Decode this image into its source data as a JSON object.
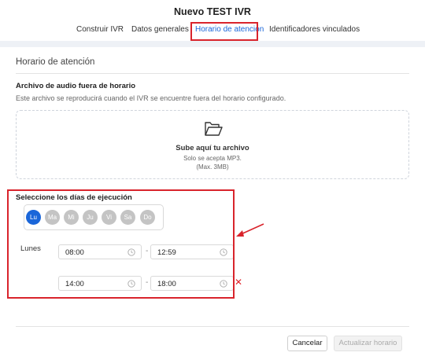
{
  "header": {
    "title": "Nuevo TEST IVR",
    "tabs": [
      {
        "label": "Construir IVR"
      },
      {
        "label": "Datos generales"
      },
      {
        "label": "Horario de atención",
        "active": true
      },
      {
        "label": "Identificadores vinculados"
      }
    ]
  },
  "section": {
    "title": "Horario de atención"
  },
  "audio": {
    "heading": "Archivo de audio fuera de horario",
    "help": "Este archivo se reproducirá cuando el IVR se encuentre fuera del horario configurado.",
    "dropzone": {
      "icon": "folder-open-icon",
      "main": "Sube aquí tu archivo",
      "sub1": "Solo se acepta MP3.",
      "sub2": "(Max. 3MB)"
    }
  },
  "schedule": {
    "heading": "Seleccione los días de ejecución",
    "days": [
      {
        "label": "Lu",
        "selected": true
      },
      {
        "label": "Ma",
        "selected": false
      },
      {
        "label": "Mi",
        "selected": false
      },
      {
        "label": "Ju",
        "selected": false
      },
      {
        "label": "Vi",
        "selected": false
      },
      {
        "label": "Sa",
        "selected": false
      },
      {
        "label": "Do",
        "selected": false
      }
    ],
    "day_name": "Lunes",
    "ranges": [
      {
        "start": "08:00",
        "end": "12:59"
      },
      {
        "start": "14:00",
        "end": "18:00",
        "removable": true
      }
    ],
    "separator": "-",
    "remove_symbol": "✕"
  },
  "footer": {
    "cancel": "Cancelar",
    "submit": "Actualizar horario"
  },
  "colors": {
    "accent": "#1a66d9",
    "annotation": "#d9242c"
  }
}
